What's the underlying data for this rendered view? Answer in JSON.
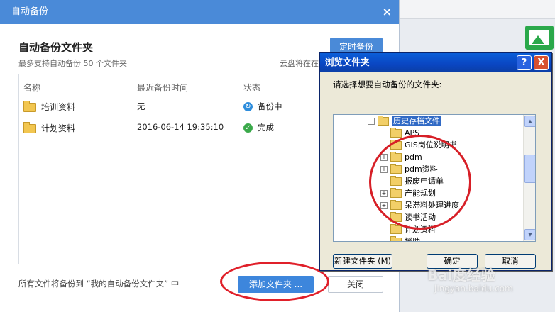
{
  "main_dialog": {
    "title": "自动备份",
    "close_glyph": "×",
    "heading": "自动备份文件夹",
    "subtitle": "最多支持自动备份 50 个文件夹",
    "cloud_note": "云盘将在在",
    "timer_button": "定时备份",
    "columns": {
      "name": "名称",
      "last_backup": "最近备份时间",
      "status": "状态"
    },
    "rows": [
      {
        "name": "培训资料",
        "time": "无",
        "status": "备份中",
        "status_icon": "sync-icon"
      },
      {
        "name": "计划资料",
        "time": "2016-06-14 19:35:10",
        "status": "完成",
        "status_icon": "check-icon"
      }
    ],
    "footer_note": "所有文件将备份到 “我的自动备份文件夹” 中",
    "add_button": "添加文件夹 ...",
    "close_button": "关闭"
  },
  "browse_dialog": {
    "title": "浏览文件夹",
    "help_glyph": "?",
    "close_glyph": "X",
    "prompt": "请选择想要自动备份的文件夹:",
    "tree": [
      {
        "label": "历史存档文件",
        "expander": "−",
        "selected": true
      },
      {
        "label": "APS",
        "expander": ""
      },
      {
        "label": "GIS岗位说明书",
        "expander": ""
      },
      {
        "label": "pdm",
        "expander": "+"
      },
      {
        "label": "pdm资料",
        "expander": "+"
      },
      {
        "label": "报废申请单",
        "expander": ""
      },
      {
        "label": "产能规划",
        "expander": "+"
      },
      {
        "label": "呆滞料处理进度",
        "expander": "+"
      },
      {
        "label": "读书活动",
        "expander": ""
      },
      {
        "label": "计划资料",
        "expander": ""
      },
      {
        "label": "援助",
        "expander": ""
      }
    ],
    "new_folder_button": "新建文件夹 (M)",
    "ok_button": "确定",
    "cancel_button": "取消"
  },
  "watermark": {
    "brand": "Bai度经验",
    "url": "jingyan.baidu.com"
  },
  "colors": {
    "accent_blue": "#4a8ad8",
    "annotation_red": "#e0202a"
  }
}
